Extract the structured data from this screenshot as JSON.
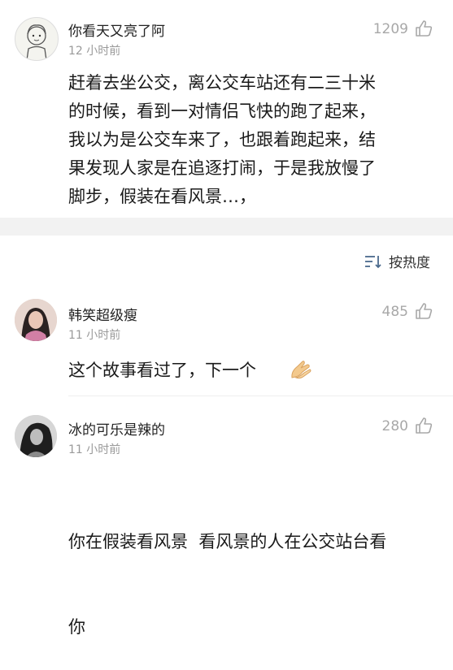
{
  "post": {
    "username": "你看天又亮了阿",
    "time": "12 小时前",
    "likes": "1209",
    "lines": [
      "赶着去坐公交，离公交车站还有二三十米",
      "的时候，看到一对情侣飞快的跑了起来，",
      "我以为是公交车来了，也跟着跑起来，结",
      "果发现人家是在追逐打闹，于是我放慢了",
      "脚步，假装在看风景…，"
    ]
  },
  "sort": {
    "label": "按热度",
    "icon": "sort-icon"
  },
  "comments": [
    {
      "username": "韩笑超级瘦",
      "time": "11 小时前",
      "likes": "485",
      "text": "这个故事看过了，下一个"
    },
    {
      "username": "冰的可乐是辣的",
      "time": "11 小时前",
      "likes": "280",
      "lines": [
        "你在假装看风景  看风景的人在公交站台看",
        "你"
      ]
    }
  ],
  "colors": {
    "muted": "#9a9a9a",
    "likes": "#a8a8a8",
    "section_gap": "#f2f2f2"
  }
}
